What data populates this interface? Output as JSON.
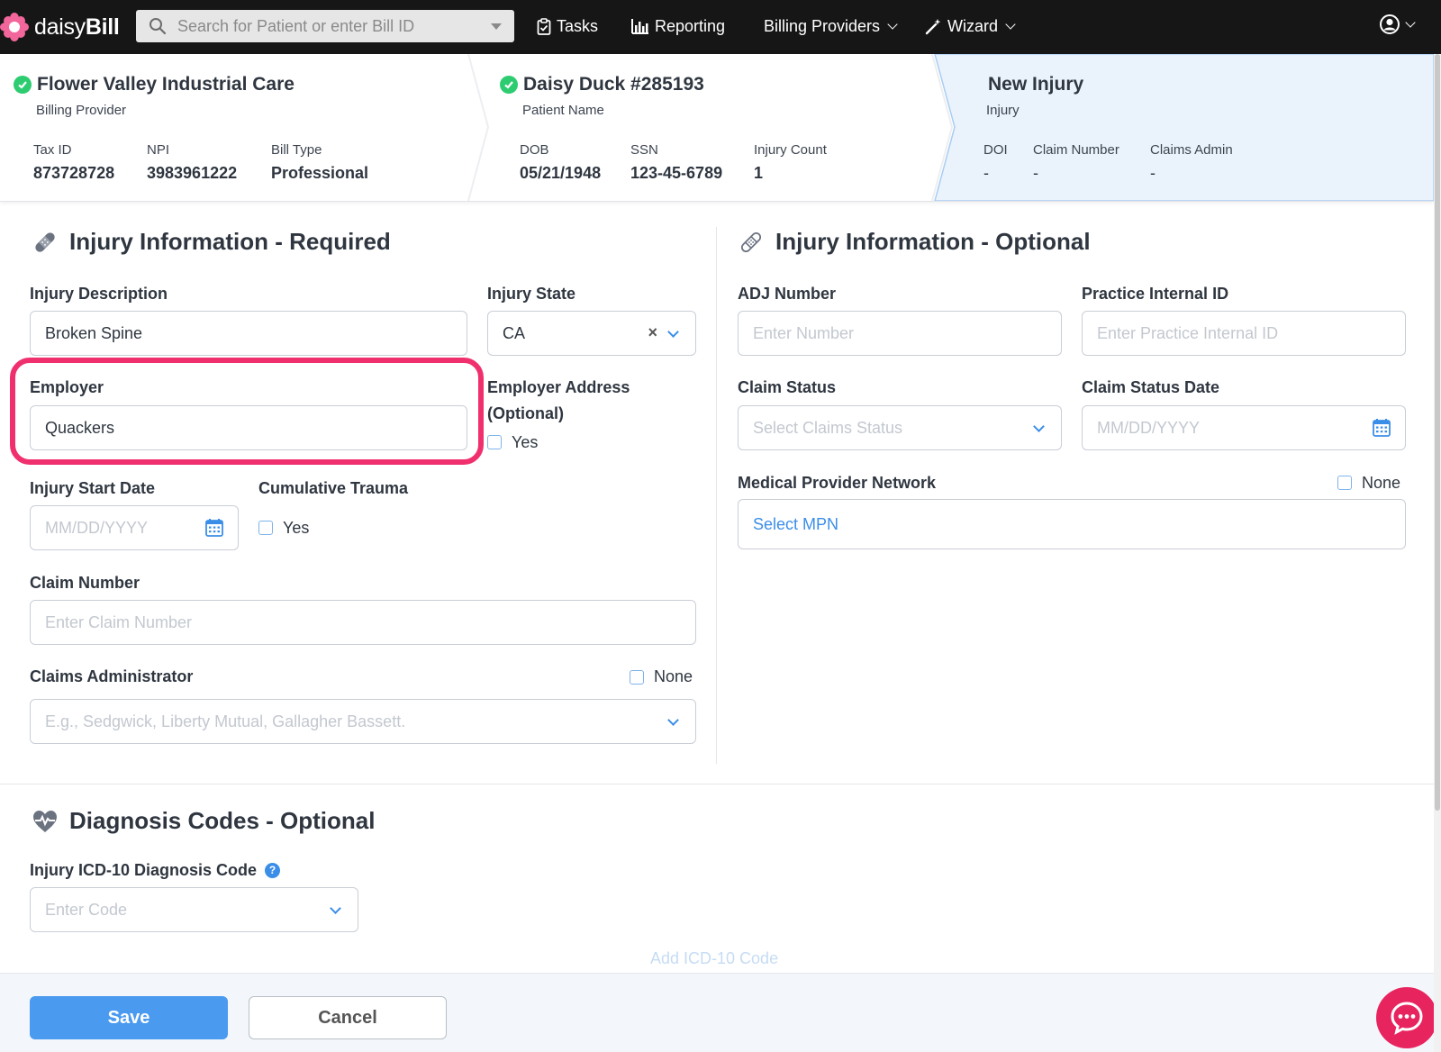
{
  "nav": {
    "brand_light": "daisy",
    "brand_bold": "Bill",
    "search_placeholder": "Search for Patient or enter Bill ID",
    "tasks": "Tasks",
    "reporting": "Reporting",
    "billing_providers": "Billing Providers",
    "wizard": "Wizard"
  },
  "crumbs": {
    "provider": {
      "title": "Flower Valley Industrial Care",
      "sub": "Billing Provider",
      "fields": [
        {
          "label": "Tax ID",
          "value": "873728728"
        },
        {
          "label": "NPI",
          "value": "3983961222"
        },
        {
          "label": "Bill Type",
          "value": "Professional"
        }
      ]
    },
    "patient": {
      "title": "Daisy Duck #285193",
      "sub": "Patient Name",
      "fields": [
        {
          "label": "DOB",
          "value": "05/21/1948"
        },
        {
          "label": "SSN",
          "value": "123-45-6789"
        },
        {
          "label": "Injury Count",
          "value": "1"
        }
      ]
    },
    "injury": {
      "title": "New Injury",
      "sub": "Injury",
      "fields": [
        {
          "label": "DOI",
          "value": "-"
        },
        {
          "label": "Claim Number",
          "value": "-"
        },
        {
          "label": "Claims Admin",
          "value": "-"
        }
      ]
    }
  },
  "required": {
    "title": "Injury Information - Required",
    "injury_description": {
      "label": "Injury Description",
      "value": "Broken Spine"
    },
    "injury_state": {
      "label": "Injury State",
      "value": "CA"
    },
    "employer": {
      "label": "Employer",
      "value": "Quackers"
    },
    "employer_address": {
      "label_line1": "Employer Address",
      "label_line2": "(Optional)",
      "checkbox": "Yes"
    },
    "injury_start_date": {
      "label": "Injury Start Date",
      "placeholder": "MM/DD/YYYY"
    },
    "cumulative_trauma": {
      "label": "Cumulative Trauma",
      "checkbox": "Yes"
    },
    "claim_number": {
      "label": "Claim Number",
      "placeholder": "Enter Claim Number"
    },
    "claims_administrator": {
      "label": "Claims Administrator",
      "none": "None",
      "placeholder": "E.g., Sedgwick, Liberty Mutual, Gallagher Bassett."
    }
  },
  "optional": {
    "title": "Injury Information - Optional",
    "adj_number": {
      "label": "ADJ Number",
      "placeholder": "Enter Number"
    },
    "practice_internal_id": {
      "label": "Practice Internal ID",
      "placeholder": "Enter Practice Internal ID"
    },
    "claim_status": {
      "label": "Claim Status",
      "placeholder": "Select Claims Status"
    },
    "claim_status_date": {
      "label": "Claim Status Date",
      "placeholder": "MM/DD/YYYY"
    },
    "mpn": {
      "label": "Medical Provider Network",
      "none": "None",
      "placeholder": "Select MPN"
    }
  },
  "diagnosis": {
    "title": "Diagnosis Codes - Optional",
    "icd_label": "Injury ICD-10 Diagnosis Code",
    "help": "?",
    "code_placeholder": "Enter Code",
    "add_code": "Add ICD-10 Code"
  },
  "footer": {
    "save": "Save",
    "cancel": "Cancel"
  },
  "colors": {
    "nav_bg": "#161616",
    "accent_blue": "#4a9af0",
    "highlight": "#f0306e",
    "check_green": "#2ecc71",
    "chat": "#e8245e"
  }
}
